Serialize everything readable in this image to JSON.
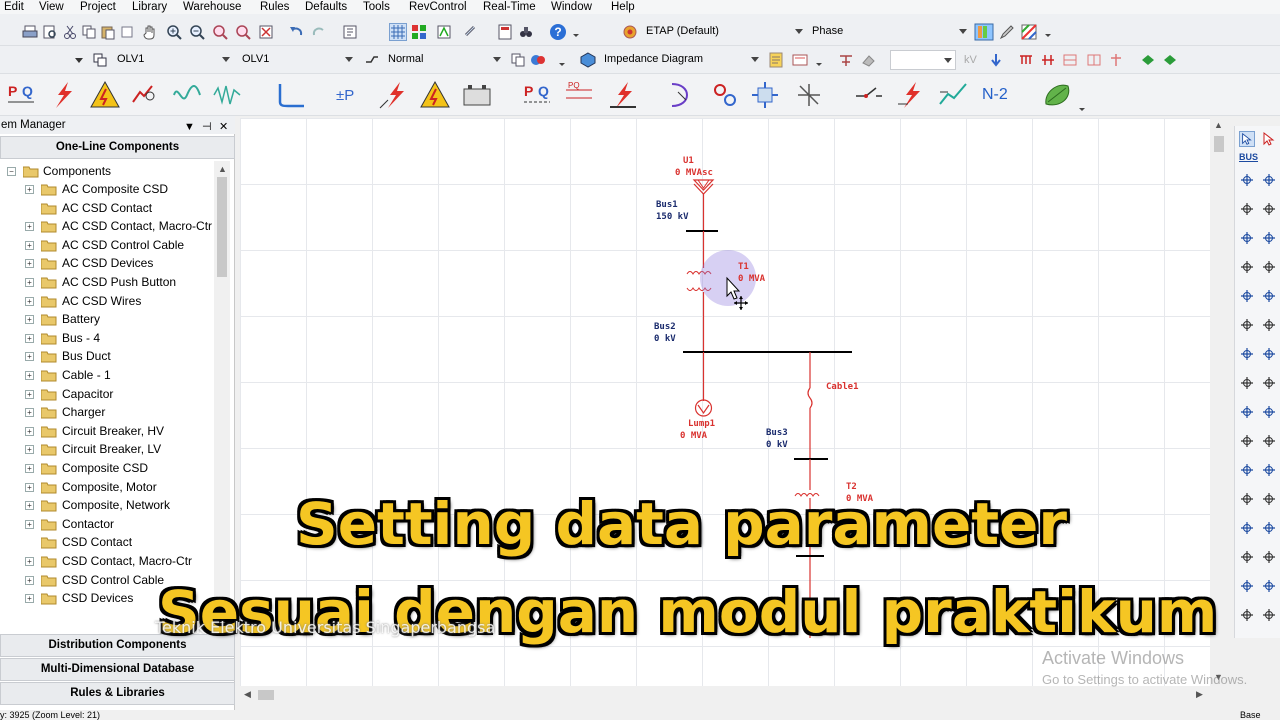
{
  "menu": {
    "items": [
      "Edit",
      "View",
      "Project",
      "Library",
      "Warehouse",
      "Rules",
      "Defaults",
      "Tools",
      "RevControl",
      "Real-Time",
      "Window",
      "Help"
    ]
  },
  "toolbar": {
    "project_combo": "ETAP (Default)",
    "phase_combo": "Phase",
    "config_combo_1": "OLV1",
    "config_combo_2": "OLV1",
    "mode_combo": "Normal",
    "diagram_combo": "Impedance Diagram",
    "kv_label": "kV",
    "n2_label": "N-2"
  },
  "panel": {
    "title": "em Manager",
    "header": "One-Line Components",
    "root": "Components",
    "items": [
      "AC Composite CSD",
      "AC CSD Contact",
      "AC CSD Contact, Macro-Ctr",
      "AC CSD Control Cable",
      "AC CSD Devices",
      "AC CSD Push Button",
      "AC CSD Wires",
      "Battery",
      "Bus - 4",
      "Bus Duct",
      "Cable - 1",
      "Capacitor",
      "Charger",
      "Circuit Breaker, HV",
      "Circuit Breaker, LV",
      "Composite CSD",
      "Composite, Motor",
      "Composite, Network",
      "Contactor",
      "CSD Contact",
      "CSD Contact, Macro-Ctr",
      "CSD Control Cable",
      "CSD Devices"
    ],
    "sections": [
      "Distribution Components",
      "Multi-Dimensional Database",
      "Rules & Libraries"
    ]
  },
  "diagram": {
    "u1_name": "U1",
    "u1_rating": "0 MVAsc",
    "bus1_name": "Bus1",
    "bus1_kv": "150 kV",
    "t1_name": "T1",
    "t1_rating": "0 MVA",
    "bus2_name": "Bus2",
    "bus2_kv": "0 kV",
    "cable1_name": "Cable1",
    "lump1_name": "Lump1",
    "lump1_rating": "0 MVA",
    "bus3_name": "Bus3",
    "bus3_kv": "0 kV",
    "t2_name": "T2",
    "t2_rating": "0 MVA"
  },
  "overlay": {
    "caption_line1": "Setting data parameter",
    "caption_line2": "Sesuai dengan modul praktikum",
    "watermark": "Teknik Elektro Universitas Singaperbangsa",
    "activate_title": "Activate Windows",
    "activate_sub": "Go to Settings to activate Windows."
  },
  "status": {
    "left": "y: 3925 (Zoom Level: 21)",
    "right": "Base"
  },
  "colors": {
    "diagram_red": "#d9322f",
    "caption_yellow": "#f5c623",
    "bus_black": "#000000"
  }
}
